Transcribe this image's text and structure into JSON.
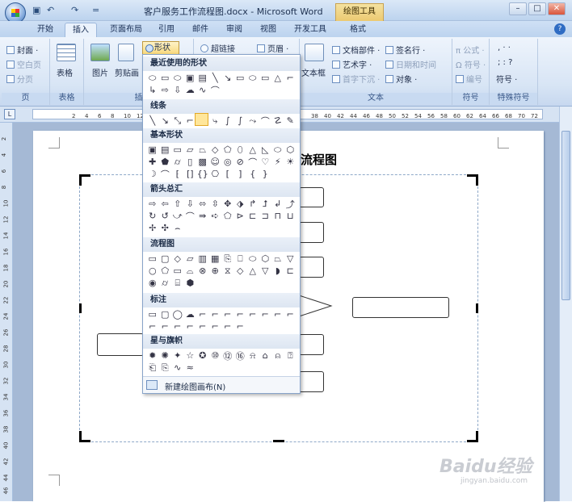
{
  "window": {
    "title": "客户服务工作流程图.docx - Microsoft Word",
    "context_tab": "绘图工具"
  },
  "qat": {
    "undo": "↶",
    "redo": "↷",
    "more": "="
  },
  "tabs": [
    {
      "label": "开始"
    },
    {
      "label": "插入"
    },
    {
      "label": "页面布局"
    },
    {
      "label": "引用"
    },
    {
      "label": "邮件"
    },
    {
      "label": "审阅"
    },
    {
      "label": "视图"
    },
    {
      "label": "开发工具"
    },
    {
      "label": "格式"
    }
  ],
  "ribbon": {
    "pages": {
      "cover": "封面 ·",
      "blank": "空白页",
      "break": "分页",
      "label": "页"
    },
    "table": {
      "btn": "表格",
      "label": "表格"
    },
    "illustrations": {
      "picture": "图片",
      "clipart": "剪贴画",
      "shapes": "形状",
      "label": "插"
    },
    "links": {
      "hyperlink": "超链接"
    },
    "header": {
      "btn": "页眉 ·"
    },
    "text": {
      "textbox": "文本框",
      "parts": "文档部件 ·",
      "wordart": "艺术字 ·",
      "dropcap": "首字下沉 ·",
      "signature": "签名行 ·",
      "datetime": "日期和时间",
      "object": "对象 ·",
      "label": "文本"
    },
    "symbols": {
      "equation": "π 公式 ·",
      "symbol": "Ω 符号 ·",
      "number": "编号",
      "label": "符号"
    },
    "special": {
      "row1": ", · ·",
      "row2": "; : ?",
      "btn": "符号 ·",
      "label": "特殊符号"
    }
  },
  "ruler": {
    "numbers": [
      "2",
      "4",
      "6",
      "8",
      "10",
      "12",
      "38",
      "40",
      "42",
      "44",
      "46",
      "48",
      "50",
      "52",
      "54",
      "56",
      "58",
      "60",
      "62",
      "64",
      "66",
      "68",
      "70",
      "72"
    ]
  },
  "vruler": {
    "numbers": [
      "2",
      "4",
      "6",
      "8",
      "10",
      "12",
      "14",
      "16",
      "18",
      "20",
      "22",
      "24",
      "26",
      "28",
      "30",
      "32",
      "34",
      "36",
      "38",
      "40",
      "42",
      "44",
      "46"
    ]
  },
  "document": {
    "title_part": "流程图"
  },
  "menu": {
    "sections": [
      {
        "title": "最近使用的形状"
      },
      {
        "title": "线条"
      },
      {
        "title": "基本形状"
      },
      {
        "title": "箭头总汇"
      },
      {
        "title": "流程图"
      },
      {
        "title": "标注"
      },
      {
        "title": "星与旗帜"
      }
    ],
    "new_canvas": "新建绘图画布(N)"
  },
  "watermark": {
    "main": "Baidu经验",
    "sub": "jingyan.baidu.com"
  }
}
